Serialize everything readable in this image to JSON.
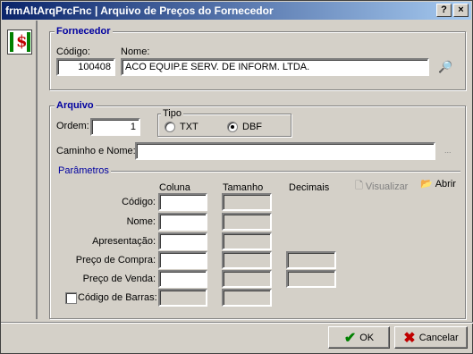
{
  "window": {
    "title": "frmAltArqPrcFnc | Arquivo de Preços do Fornecedor",
    "help_button": "?",
    "close_button": "×"
  },
  "fornecedor": {
    "legend": "Fornecedor",
    "codigo_label": "Código:",
    "codigo_value": "100408",
    "nome_label": "Nome:",
    "nome_value": "ACO EQUIP.E SERV. DE INFORM. LTDA."
  },
  "arquivo": {
    "legend": "Arquivo",
    "ordem_label": "Ordem:",
    "ordem_value": "1",
    "tipo_legend": "Tipo",
    "tipo_options": [
      {
        "label": "TXT",
        "selected": false
      },
      {
        "label": "DBF",
        "selected": true
      }
    ],
    "caminho_label": "Caminho e Nome:",
    "caminho_value": "",
    "browse_label": "..."
  },
  "parametros": {
    "legend": "Parâmetros",
    "headers": {
      "coluna": "Coluna",
      "tamanho": "Tamanho",
      "decimais": "Decimais"
    },
    "visualizar_label": "Visualizar",
    "abrir_label": "Abrir",
    "rows": [
      {
        "label": "Código:"
      },
      {
        "label": "Nome:"
      },
      {
        "label": "Apresentação:"
      },
      {
        "label": "Preço de Compra:"
      },
      {
        "label": "Preço de Venda:"
      },
      {
        "label": "Código de Barras:"
      }
    ]
  },
  "footer": {
    "ok_label": "OK",
    "cancel_label": "Cancelar"
  },
  "colors": {
    "legend": "#0000a0",
    "title_start": "#0a246a",
    "ok_check": "#008000",
    "cancel_x": "#c00000"
  }
}
